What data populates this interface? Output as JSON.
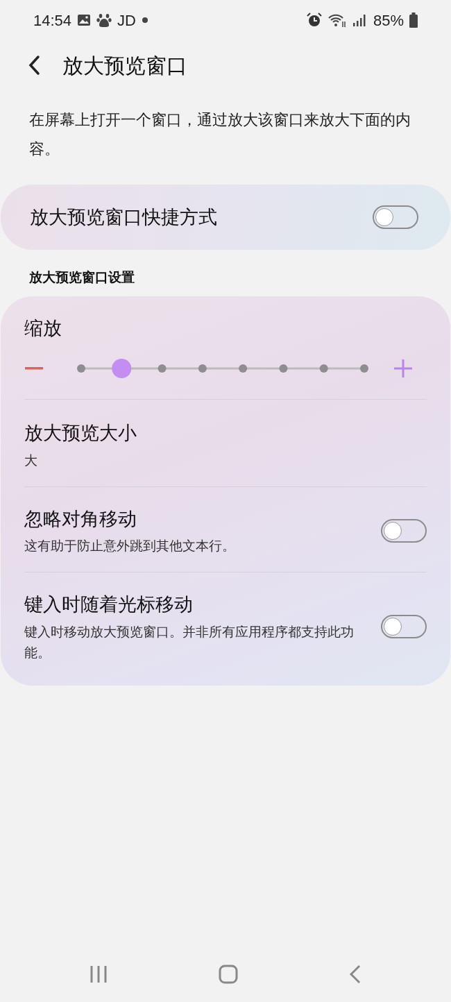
{
  "status_bar": {
    "time": "14:54",
    "notification_text": "JD",
    "battery": "85%"
  },
  "header": {
    "title": "放大预览窗口"
  },
  "description": "在屏幕上打开一个窗口，通过放大该窗口来放大下面的内容。",
  "shortcut": {
    "label": "放大预览窗口快捷方式",
    "on": false
  },
  "section_title": "放大预览窗口设置",
  "settings": [
    {
      "kind": "slider",
      "label": "缩放",
      "level": 0.143
    },
    {
      "kind": "value",
      "label": "放大预览大小",
      "value": "大"
    },
    {
      "kind": "toggle",
      "label": "忽略对角移动",
      "description": "这有助于防止意外跳到其他文本行。",
      "on": false
    },
    {
      "kind": "toggle",
      "label": "键入时随着光标移动",
      "description": "键入时移动放大预览窗口。并非所有应用程序都支持此功能。",
      "on": false
    }
  ]
}
